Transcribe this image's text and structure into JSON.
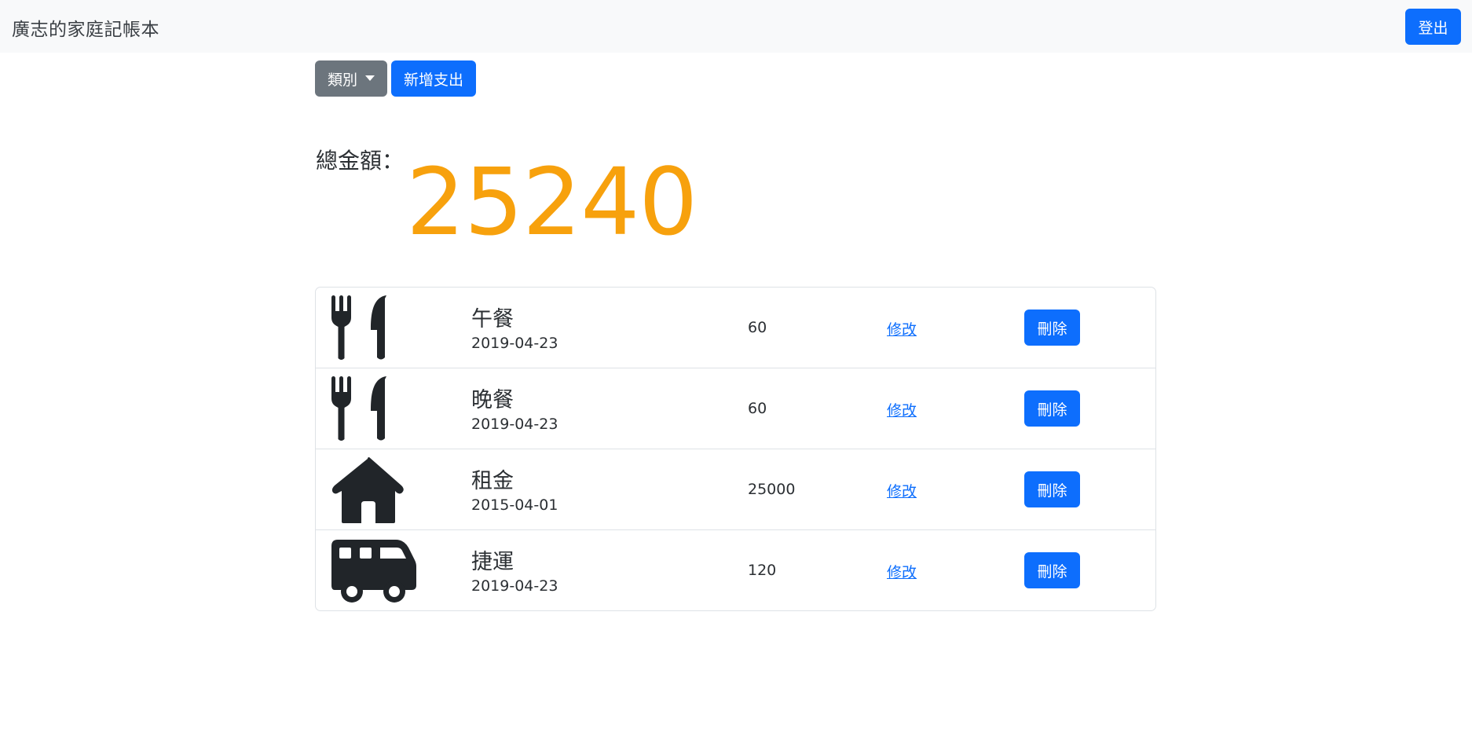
{
  "navbar": {
    "brand": "廣志的家庭記帳本",
    "logout_label": "登出"
  },
  "toolbar": {
    "category_label": "類別",
    "add_label": "新增支出"
  },
  "summary": {
    "total_label": "總金額：",
    "total_value": "25240",
    "total_color": "#f7a10d"
  },
  "expenses": [
    {
      "icon": "utensils-icon",
      "name": "午餐",
      "date": "2019-04-23",
      "amount": "60",
      "edit_label": "修改",
      "delete_label": "刪除"
    },
    {
      "icon": "utensils-icon",
      "name": "晚餐",
      "date": "2019-04-23",
      "amount": "60",
      "edit_label": "修改",
      "delete_label": "刪除"
    },
    {
      "icon": "house-icon",
      "name": "租金",
      "date": "2015-04-01",
      "amount": "25000",
      "edit_label": "修改",
      "delete_label": "刪除"
    },
    {
      "icon": "bus-icon",
      "name": "捷運",
      "date": "2019-04-23",
      "amount": "120",
      "edit_label": "修改",
      "delete_label": "刪除"
    }
  ],
  "colors": {
    "primary": "#0d6efd",
    "secondary": "#6c757d",
    "navbar_bg": "#f8f9fa"
  }
}
